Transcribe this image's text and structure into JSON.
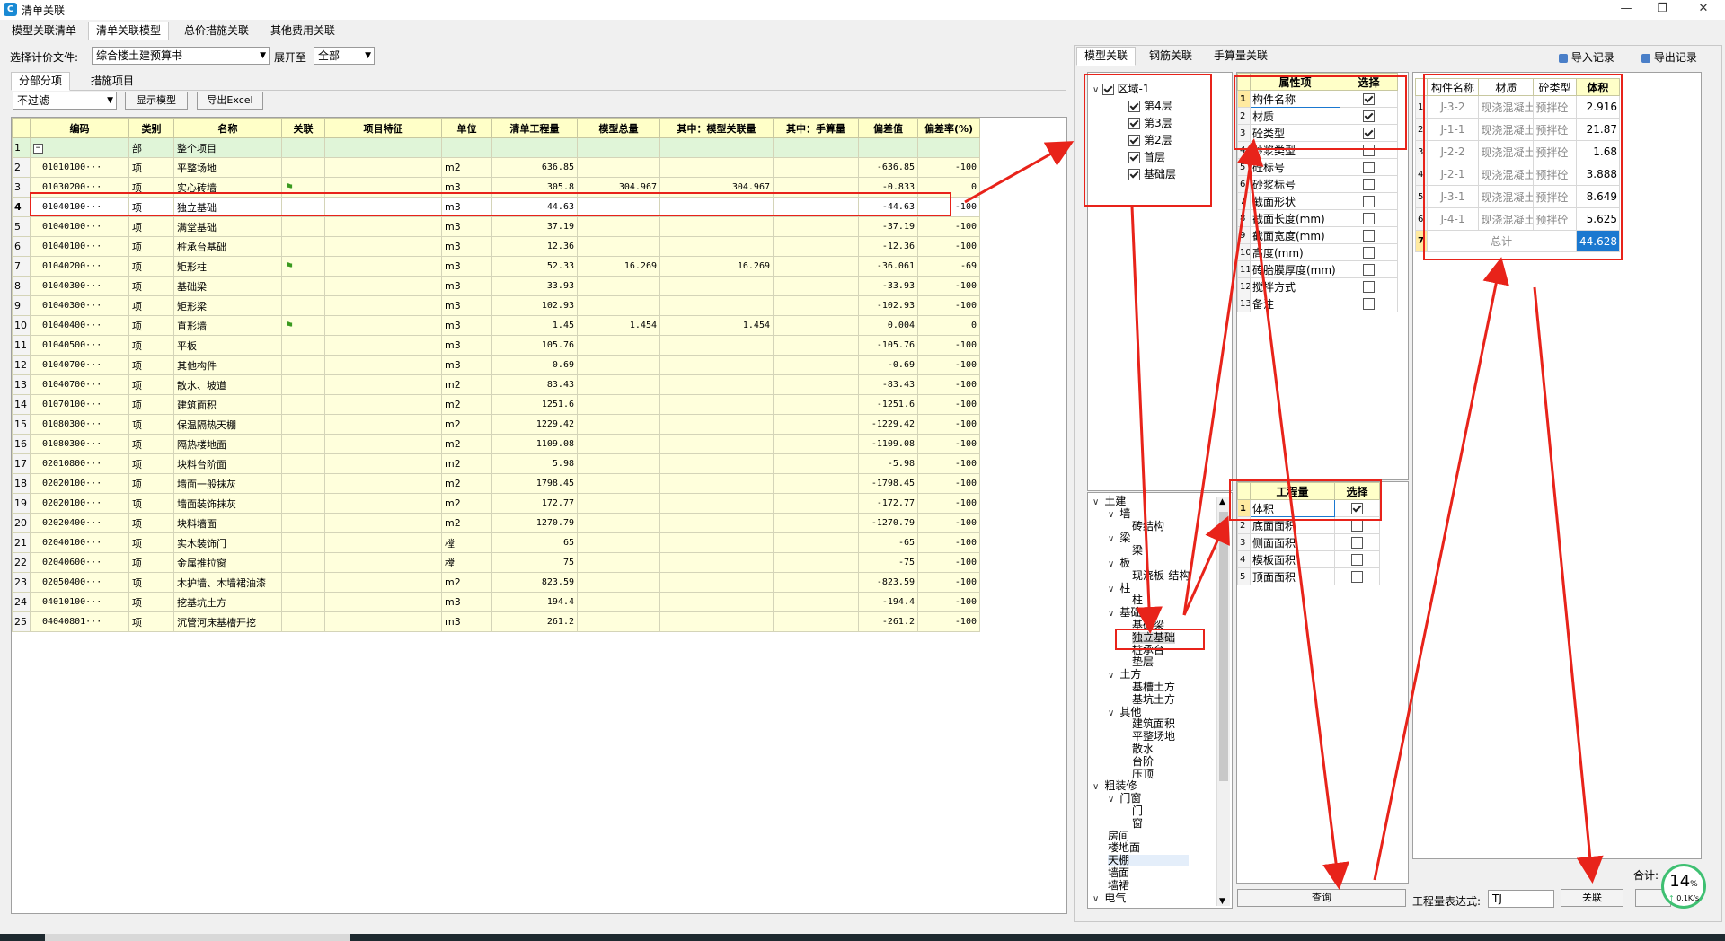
{
  "window": {
    "title": "清单关联",
    "min": "—",
    "max": "❐",
    "close": "✕"
  },
  "main_tabs": [
    "模型关联清单",
    "清单关联模型",
    "总价措施关联",
    "其他费用关联"
  ],
  "toolbar": {
    "file_label": "选择计价文件:",
    "file_value": "综合楼土建预算书",
    "expand_label": "展开至",
    "expand_value": "全部",
    "sub_tabs": [
      "分部分项",
      "措施项目"
    ],
    "filter_value": "不过滤",
    "show_model_btn": "显示模型",
    "export_btn": "导出Excel"
  },
  "grid": {
    "headers": [
      "编码",
      "类别",
      "名称",
      "关联",
      "项目特征",
      "单位",
      "清单工程量",
      "模型总量",
      "其中：模型关联量",
      "其中：手算量",
      "偏差值",
      "偏差率(%)"
    ],
    "rows": [
      {
        "n": "1",
        "code": "",
        "type": "部",
        "name": "整个项目",
        "flag": false,
        "unit": "",
        "qty": "",
        "model": "",
        "rel": "",
        "hand": "",
        "dev": "",
        "rate": "",
        "bu": true
      },
      {
        "n": "2",
        "code": "01010100···",
        "type": "项",
        "name": "平整场地",
        "flag": false,
        "unit": "m2",
        "qty": "636.85",
        "model": "",
        "rel": "",
        "hand": "",
        "dev": "-636.85",
        "rate": "-100"
      },
      {
        "n": "3",
        "code": "01030200···",
        "type": "项",
        "name": "实心砖墙",
        "flag": true,
        "unit": "m3",
        "qty": "305.8",
        "model": "304.967",
        "rel": "304.967",
        "hand": "",
        "dev": "-0.833",
        "rate": "0"
      },
      {
        "n": "4",
        "code": "01040100···",
        "type": "项",
        "name": "独立基础",
        "flag": false,
        "unit": "m3",
        "qty": "44.63",
        "model": "",
        "rel": "",
        "hand": "",
        "dev": "-44.63",
        "rate": "-100",
        "sel": true
      },
      {
        "n": "5",
        "code": "01040100···",
        "type": "项",
        "name": "满堂基础",
        "flag": false,
        "unit": "m3",
        "qty": "37.19",
        "model": "",
        "rel": "",
        "hand": "",
        "dev": "-37.19",
        "rate": "-100"
      },
      {
        "n": "6",
        "code": "01040100···",
        "type": "项",
        "name": "桩承台基础",
        "flag": false,
        "unit": "m3",
        "qty": "12.36",
        "model": "",
        "rel": "",
        "hand": "",
        "dev": "-12.36",
        "rate": "-100"
      },
      {
        "n": "7",
        "code": "01040200···",
        "type": "项",
        "name": "矩形柱",
        "flag": true,
        "unit": "m3",
        "qty": "52.33",
        "model": "16.269",
        "rel": "16.269",
        "hand": "",
        "dev": "-36.061",
        "rate": "-69"
      },
      {
        "n": "8",
        "code": "01040300···",
        "type": "项",
        "name": "基础梁",
        "flag": false,
        "unit": "m3",
        "qty": "33.93",
        "model": "",
        "rel": "",
        "hand": "",
        "dev": "-33.93",
        "rate": "-100"
      },
      {
        "n": "9",
        "code": "01040300···",
        "type": "项",
        "name": "矩形梁",
        "flag": false,
        "unit": "m3",
        "qty": "102.93",
        "model": "",
        "rel": "",
        "hand": "",
        "dev": "-102.93",
        "rate": "-100"
      },
      {
        "n": "10",
        "code": "01040400···",
        "type": "项",
        "name": "直形墙",
        "flag": true,
        "unit": "m3",
        "qty": "1.45",
        "model": "1.454",
        "rel": "1.454",
        "hand": "",
        "dev": "0.004",
        "rate": "0"
      },
      {
        "n": "11",
        "code": "01040500···",
        "type": "项",
        "name": "平板",
        "flag": false,
        "unit": "m3",
        "qty": "105.76",
        "model": "",
        "rel": "",
        "hand": "",
        "dev": "-105.76",
        "rate": "-100"
      },
      {
        "n": "12",
        "code": "01040700···",
        "type": "项",
        "name": "其他构件",
        "flag": false,
        "unit": "m3",
        "qty": "0.69",
        "model": "",
        "rel": "",
        "hand": "",
        "dev": "-0.69",
        "rate": "-100"
      },
      {
        "n": "13",
        "code": "01040700···",
        "type": "项",
        "name": "散水、坡道",
        "flag": false,
        "unit": "m2",
        "qty": "83.43",
        "model": "",
        "rel": "",
        "hand": "",
        "dev": "-83.43",
        "rate": "-100"
      },
      {
        "n": "14",
        "code": "01070100···",
        "type": "项",
        "name": "建筑面积",
        "flag": false,
        "unit": "m2",
        "qty": "1251.6",
        "model": "",
        "rel": "",
        "hand": "",
        "dev": "-1251.6",
        "rate": "-100"
      },
      {
        "n": "15",
        "code": "01080300···",
        "type": "项",
        "name": "保温隔热天棚",
        "flag": false,
        "unit": "m2",
        "qty": "1229.42",
        "model": "",
        "rel": "",
        "hand": "",
        "dev": "-1229.42",
        "rate": "-100"
      },
      {
        "n": "16",
        "code": "01080300···",
        "type": "项",
        "name": "隔热楼地面",
        "flag": false,
        "unit": "m2",
        "qty": "1109.08",
        "model": "",
        "rel": "",
        "hand": "",
        "dev": "-1109.08",
        "rate": "-100"
      },
      {
        "n": "17",
        "code": "02010800···",
        "type": "项",
        "name": "块料台阶面",
        "flag": false,
        "unit": "m2",
        "qty": "5.98",
        "model": "",
        "rel": "",
        "hand": "",
        "dev": "-5.98",
        "rate": "-100"
      },
      {
        "n": "18",
        "code": "02020100···",
        "type": "项",
        "name": "墙面一般抹灰",
        "flag": false,
        "unit": "m2",
        "qty": "1798.45",
        "model": "",
        "rel": "",
        "hand": "",
        "dev": "-1798.45",
        "rate": "-100"
      },
      {
        "n": "19",
        "code": "02020100···",
        "type": "项",
        "name": "墙面装饰抹灰",
        "flag": false,
        "unit": "m2",
        "qty": "172.77",
        "model": "",
        "rel": "",
        "hand": "",
        "dev": "-172.77",
        "rate": "-100"
      },
      {
        "n": "20",
        "code": "02020400···",
        "type": "项",
        "name": "块料墙面",
        "flag": false,
        "unit": "m2",
        "qty": "1270.79",
        "model": "",
        "rel": "",
        "hand": "",
        "dev": "-1270.79",
        "rate": "-100"
      },
      {
        "n": "21",
        "code": "02040100···",
        "type": "项",
        "name": "实木装饰门",
        "flag": false,
        "unit": "樘",
        "qty": "65",
        "model": "",
        "rel": "",
        "hand": "",
        "dev": "-65",
        "rate": "-100"
      },
      {
        "n": "22",
        "code": "02040600···",
        "type": "项",
        "name": "金属推拉窗",
        "flag": false,
        "unit": "樘",
        "qty": "75",
        "model": "",
        "rel": "",
        "hand": "",
        "dev": "-75",
        "rate": "-100"
      },
      {
        "n": "23",
        "code": "02050400···",
        "type": "项",
        "name": "木护墙、木墙裙油漆",
        "flag": false,
        "unit": "m2",
        "qty": "823.59",
        "model": "",
        "rel": "",
        "hand": "",
        "dev": "-823.59",
        "rate": "-100"
      },
      {
        "n": "24",
        "code": "04010100···",
        "type": "项",
        "name": "挖基坑土方",
        "flag": false,
        "unit": "m3",
        "qty": "194.4",
        "model": "",
        "rel": "",
        "hand": "",
        "dev": "-194.4",
        "rate": "-100"
      },
      {
        "n": "25",
        "code": "04040801···",
        "type": "项",
        "name": "沉管河床基槽开挖",
        "flag": false,
        "unit": "m3",
        "qty": "261.2",
        "model": "",
        "rel": "",
        "hand": "",
        "dev": "-261.2",
        "rate": "-100"
      }
    ]
  },
  "right_tabs": [
    "模型关联",
    "钢筋关联",
    "手算量关联"
  ],
  "import_record": "导入记录",
  "export_record": "导出记录",
  "floor_tree": {
    "root": "区域-1",
    "items": [
      "第4层",
      "第3层",
      "第2层",
      "首层",
      "基础层"
    ]
  },
  "attr_table": {
    "headers": [
      "属性项",
      "选择"
    ],
    "rows": [
      {
        "n": "1",
        "name": "构件名称",
        "on": true
      },
      {
        "n": "2",
        "name": "材质",
        "on": true
      },
      {
        "n": "3",
        "name": "砼类型",
        "on": true
      },
      {
        "n": "4",
        "name": "砂浆类型",
        "on": false
      },
      {
        "n": "5",
        "name": "砼标号",
        "on": false
      },
      {
        "n": "6",
        "name": "砂浆标号",
        "on": false
      },
      {
        "n": "7",
        "name": "截面形状",
        "on": false
      },
      {
        "n": "8",
        "name": "截面长度(mm)",
        "on": false
      },
      {
        "n": "9",
        "name": "截面宽度(mm)",
        "on": false
      },
      {
        "n": "10",
        "name": "高度(mm)",
        "on": false
      },
      {
        "n": "11",
        "name": "砖胎膜厚度(mm)",
        "on": false
      },
      {
        "n": "12",
        "name": "搅拌方式",
        "on": false
      },
      {
        "n": "13",
        "name": "备注",
        "on": false
      }
    ]
  },
  "qty_table": {
    "headers": [
      "工程量",
      "选择"
    ],
    "rows": [
      {
        "n": "1",
        "name": "体积",
        "on": true
      },
      {
        "n": "2",
        "name": "底面面积",
        "on": false
      },
      {
        "n": "3",
        "name": "侧面面积",
        "on": false
      },
      {
        "n": "4",
        "name": "模板面积",
        "on": false
      },
      {
        "n": "5",
        "name": "顶面面积",
        "on": false
      }
    ]
  },
  "comp_tree": [
    {
      "t": "土建",
      "lvl": 0,
      "exp": true
    },
    {
      "t": "墙",
      "lvl": 1,
      "exp": true
    },
    {
      "t": "砖结构",
      "lvl": 2
    },
    {
      "t": "梁",
      "lvl": 1,
      "exp": true
    },
    {
      "t": "梁",
      "lvl": 2
    },
    {
      "t": "板",
      "lvl": 1,
      "exp": true
    },
    {
      "t": "现浇板-结构",
      "lvl": 2
    },
    {
      "t": "柱",
      "lvl": 1,
      "exp": true
    },
    {
      "t": "柱",
      "lvl": 2
    },
    {
      "t": "基础",
      "lvl": 1,
      "exp": true
    },
    {
      "t": "基础梁",
      "lvl": 2
    },
    {
      "t": "独立基础",
      "lvl": 2,
      "sel": true
    },
    {
      "t": "桩承台",
      "lvl": 2
    },
    {
      "t": "垫层",
      "lvl": 2
    },
    {
      "t": "土方",
      "lvl": 1,
      "exp": true
    },
    {
      "t": "基槽土方",
      "lvl": 2
    },
    {
      "t": "基坑土方",
      "lvl": 2
    },
    {
      "t": "其他",
      "lvl": 1,
      "exp": true
    },
    {
      "t": "建筑面积",
      "lvl": 2
    },
    {
      "t": "平整场地",
      "lvl": 2
    },
    {
      "t": "散水",
      "lvl": 2
    },
    {
      "t": "台阶",
      "lvl": 2
    },
    {
      "t": "压顶",
      "lvl": 2
    },
    {
      "t": "粗装修",
      "lvl": 0,
      "exp": true
    },
    {
      "t": "门窗",
      "lvl": 1,
      "exp": true
    },
    {
      "t": "门",
      "lvl": 2
    },
    {
      "t": "窗",
      "lvl": 2
    },
    {
      "t": "房间",
      "lvl": 1
    },
    {
      "t": "楼地面",
      "lvl": 1
    },
    {
      "t": "天棚",
      "lvl": 1,
      "hl": true
    },
    {
      "t": "墙面",
      "lvl": 1
    },
    {
      "t": "墙裙",
      "lvl": 1
    },
    {
      "t": "电气",
      "lvl": 0,
      "exp": true
    }
  ],
  "result_table": {
    "headers": [
      "构件名称",
      "材质",
      "砼类型",
      "体积"
    ],
    "rows": [
      {
        "n": "1",
        "name": "J-3-2",
        "mat": "现浇混凝土",
        "con": "预拌砼",
        "vol": "2.916"
      },
      {
        "n": "2",
        "name": "J-1-1",
        "mat": "现浇混凝土",
        "con": "预拌砼",
        "vol": "21.87"
      },
      {
        "n": "3",
        "name": "J-2-2",
        "mat": "现浇混凝土",
        "con": "预拌砼",
        "vol": "1.68"
      },
      {
        "n": "4",
        "name": "J-2-1",
        "mat": "现浇混凝土",
        "con": "预拌砼",
        "vol": "3.888"
      },
      {
        "n": "5",
        "name": "J-3-1",
        "mat": "现浇混凝土",
        "con": "预拌砼",
        "vol": "8.649"
      },
      {
        "n": "6",
        "name": "J-4-1",
        "mat": "现浇混凝土",
        "con": "预拌砼",
        "vol": "5.625"
      }
    ],
    "total_n": "7",
    "total_label": "总计",
    "total_value": "44.628"
  },
  "query_btn": "查询",
  "expr_label": "工程量表达式:",
  "expr_value": "TJ",
  "link_btn": "关联",
  "sum_label": "合计:",
  "net": {
    "pct": "14",
    "pct_unit": "%",
    "speed": "0.1K/s"
  },
  "colors": {
    "red": "#e8231a",
    "header": "#ffffc8",
    "row": "#ffffdc",
    "selected_cell": "#1a78d0"
  }
}
